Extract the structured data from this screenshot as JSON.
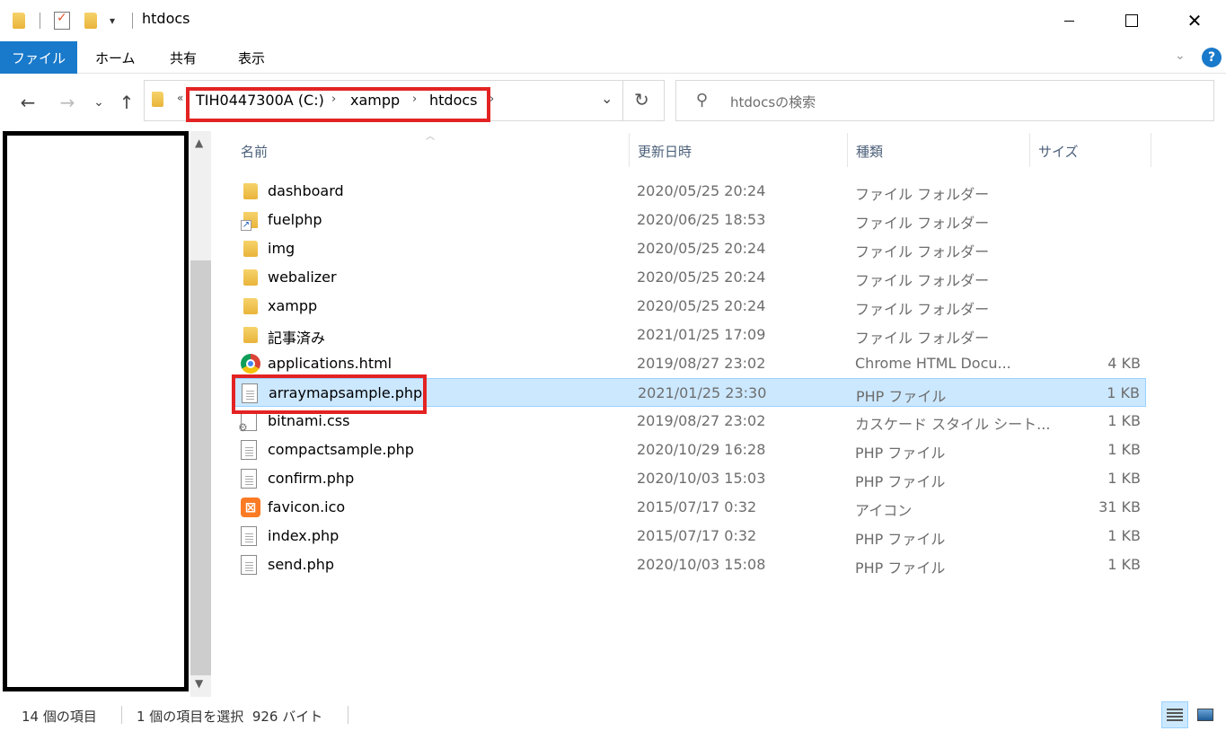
{
  "window": {
    "title": "htdocs",
    "minimize_glyph": "",
    "maximize_glyph": "",
    "close_glyph": "✕"
  },
  "ribbon": {
    "tabs": [
      "ファイル",
      "ホーム",
      "共有",
      "表示"
    ],
    "help": "?"
  },
  "nav": {
    "back": "←",
    "forward": "→",
    "recent": "⌄",
    "up": "↑"
  },
  "address": {
    "overflow": "«",
    "crumbs": [
      "TIH0447300A (C:)",
      "xampp",
      "htdocs"
    ],
    "separator": "›",
    "dropdown": "⌄",
    "refresh": "↻"
  },
  "search": {
    "placeholder": "htdocsの検索"
  },
  "columns": {
    "name": "名前",
    "date": "更新日時",
    "type": "種類",
    "size": "サイズ"
  },
  "files": [
    {
      "name": "dashboard",
      "date": "2020/05/25 20:24",
      "type": "ファイル フォルダー",
      "size": "",
      "icon": "folder-icon"
    },
    {
      "name": "fuelphp",
      "date": "2020/06/25 18:53",
      "type": "ファイル フォルダー",
      "size": "",
      "icon": "shortcut-folder-icon"
    },
    {
      "name": "img",
      "date": "2020/05/25 20:24",
      "type": "ファイル フォルダー",
      "size": "",
      "icon": "folder-icon"
    },
    {
      "name": "webalizer",
      "date": "2020/05/25 20:24",
      "type": "ファイル フォルダー",
      "size": "",
      "icon": "folder-icon"
    },
    {
      "name": "xampp",
      "date": "2020/05/25 20:24",
      "type": "ファイル フォルダー",
      "size": "",
      "icon": "folder-icon"
    },
    {
      "name": "記事済み",
      "date": "2021/01/25 17:09",
      "type": "ファイル フォルダー",
      "size": "",
      "icon": "folder-icon"
    },
    {
      "name": "applications.html",
      "date": "2019/08/27 23:02",
      "type": "Chrome HTML Docu...",
      "size": "4 KB",
      "icon": "chrome-icon"
    },
    {
      "name": "arraymapsample.php",
      "date": "2021/01/25 23:30",
      "type": "PHP ファイル",
      "size": "1 KB",
      "icon": "document-icon"
    },
    {
      "name": "bitnami.css",
      "date": "2019/08/27 23:02",
      "type": "カスケード スタイル シート...",
      "size": "1 KB",
      "icon": "css-file-icon"
    },
    {
      "name": "compactsample.php",
      "date": "2020/10/29 16:28",
      "type": "PHP ファイル",
      "size": "1 KB",
      "icon": "document-icon"
    },
    {
      "name": "confirm.php",
      "date": "2020/10/03 15:03",
      "type": "PHP ファイル",
      "size": "1 KB",
      "icon": "document-icon"
    },
    {
      "name": "favicon.ico",
      "date": "2015/07/17 0:32",
      "type": "アイコン",
      "size": "31 KB",
      "icon": "xampp-icon"
    },
    {
      "name": "index.php",
      "date": "2015/07/17 0:32",
      "type": "PHP ファイル",
      "size": "1 KB",
      "icon": "document-icon"
    },
    {
      "name": "send.php",
      "date": "2020/10/03 15:08",
      "type": "PHP ファイル",
      "size": "1 KB",
      "icon": "document-icon"
    }
  ],
  "selected_file": "arraymapsample.php",
  "status": {
    "item_count": "14 個の項目",
    "selection": "1 個の項目を選択  926 バイト"
  },
  "colors": {
    "accent": "#1979ca",
    "selection_bg": "#cce8ff",
    "highlight_box": "#e32323"
  }
}
